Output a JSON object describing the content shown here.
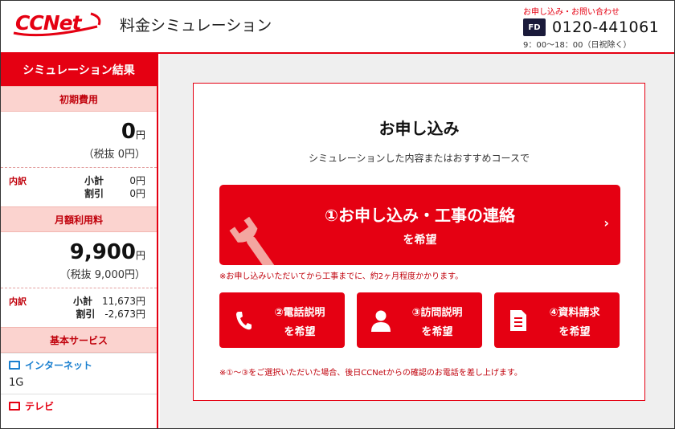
{
  "header": {
    "logo": "CCNet",
    "title": "料金シミュレーション",
    "contact_label": "お申し込み・お問い合わせ",
    "freedial_icon": "freedial-icon",
    "phone": "0120-441061",
    "hours": "9：00〜18：00（日祝除く）"
  },
  "sidebar": {
    "heading": "シミュレーション結果",
    "initial": {
      "label": "初期費用",
      "amount": "0",
      "unit": "円",
      "tax_note": "（税抜 0円）",
      "breakdown_label": "内訳",
      "subtotal_label": "小計",
      "subtotal_value": "0円",
      "discount_label": "割引",
      "discount_value": "0円"
    },
    "monthly": {
      "label": "月額利用料",
      "amount": "9,900",
      "unit": "円",
      "tax_note": "（税抜 9,000円）",
      "breakdown_label": "内訳",
      "subtotal_label": "小計",
      "subtotal_value": "11,673円",
      "discount_label": "割引",
      "discount_value": "-2,673円"
    },
    "basic_services": {
      "label": "基本サービス",
      "internet_label": "インターネット",
      "internet_value": "1G",
      "tv_label": "テレビ"
    }
  },
  "main": {
    "title": "お申し込み",
    "subtitle": "シミュレーションした内容またはおすすめコースで",
    "apply_button": {
      "line1": "①お申し込み・工事の連絡",
      "line2": "を希望",
      "chevron": "›"
    },
    "note1": "※お申し込みいただいてから工事までに、約2ヶ月程度かかります。",
    "buttons": [
      {
        "line1": "②電話説明",
        "line2": "を希望",
        "icon": "phone-icon"
      },
      {
        "line1": "③訪問説明",
        "line2": "を希望",
        "icon": "person-icon"
      },
      {
        "line1": "④資料請求",
        "line2": "を希望",
        "icon": "document-icon"
      }
    ],
    "note2": "※①〜③をご選択いただいた場合、後日CCNetからの確認のお電話を差し上げます。"
  },
  "colors": {
    "accent": "#e50012",
    "light_accent": "#fbd3cf",
    "internet_blue": "#1a7fcf"
  }
}
